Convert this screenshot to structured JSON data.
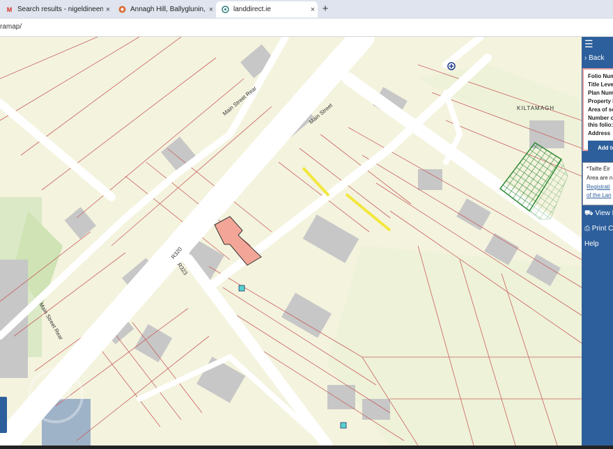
{
  "browser": {
    "tabs": [
      {
        "label": "Search results - nigeldineenauc",
        "icon": "gmail-icon",
        "active": false
      },
      {
        "label": "Annagh Hill, Ballyglunin, Tuam",
        "icon": "site-icon",
        "active": false
      },
      {
        "label": "landdirect.ie",
        "icon": "landdirect-icon",
        "active": true
      }
    ],
    "new_tab": "+",
    "close": "×",
    "url": "ramap/"
  },
  "map": {
    "street_labels": [
      "Main Street Rear",
      "Main Street",
      "R320",
      "R323",
      "Main Street Rear"
    ],
    "place_label": "KILTAMAGH",
    "colors": {
      "background": "#f4f3de",
      "road": "#ffffff",
      "building": "#c7c7c7",
      "boundary": "#c8605f",
      "green": "#dbe9c6",
      "highlight_parcel": "#f3a697",
      "yellow": "#f2e73c",
      "hatched": "#2e8a36",
      "marker": "#57d2d0"
    }
  },
  "panel": {
    "menu_icon": "☰",
    "back": "Back",
    "folio_rows": [
      "Folio Num",
      "Title Level",
      "Plan Num",
      "Property N",
      "Area of se",
      "Number o",
      "this folio:",
      "Address"
    ],
    "add_button": "Add to",
    "note_lines": [
      "*Tailte Éir",
      "Area are n",
      "Registrati",
      "of the Lan"
    ],
    "links": [
      {
        "label": "View E",
        "icon": "cart-icon"
      },
      {
        "label": "Print C",
        "icon": "print-icon"
      },
      {
        "label": "Help",
        "icon": ""
      }
    ]
  }
}
